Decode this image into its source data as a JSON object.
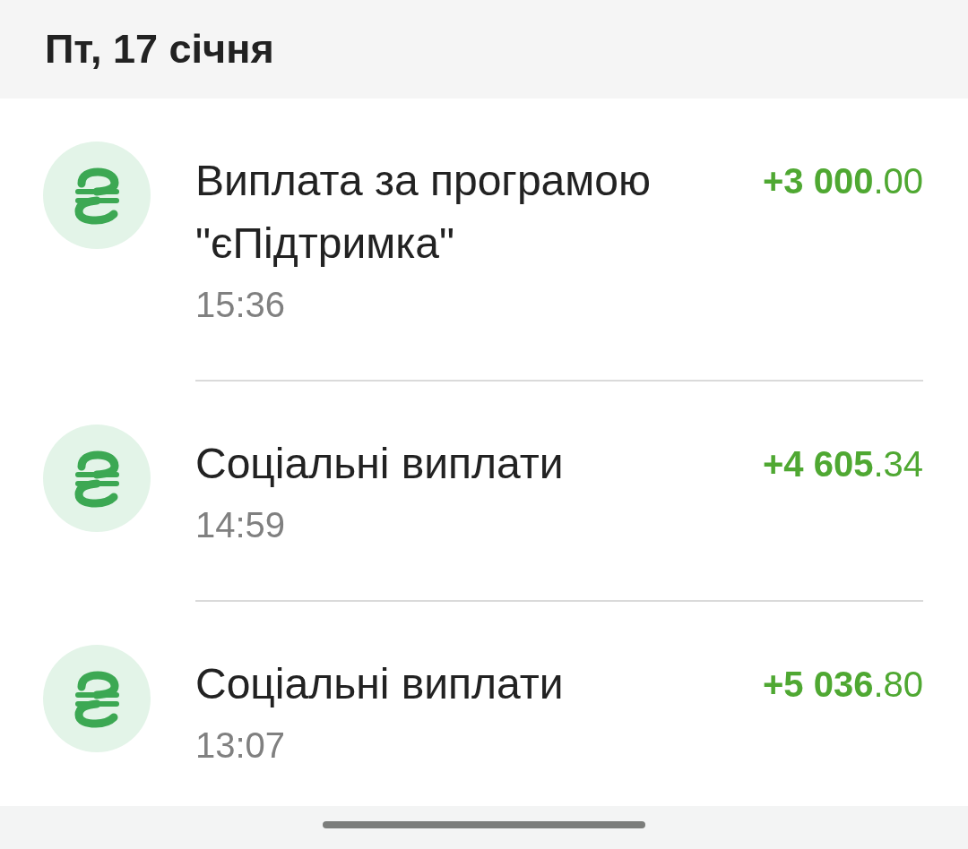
{
  "header": {
    "date": "Пт, 17 січня"
  },
  "transactions": [
    {
      "title": "Виплата за програмою \"єПідтримка\"",
      "time": "15:36",
      "amount": "**+3 000**.00"
    },
    {
      "title": "Соціальні виплати",
      "time": "14:59",
      "amount": "**+4 605**.34"
    },
    {
      "title": "Соціальні виплати",
      "time": "13:07",
      "amount": "**+5 036**.80"
    }
  ]
}
